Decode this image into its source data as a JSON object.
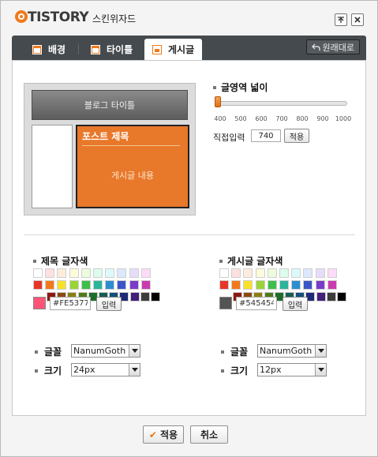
{
  "window": {
    "brand": "TISTORY",
    "title": "스킨위자드",
    "pin_icon": "pin-icon",
    "close_icon": "close-icon"
  },
  "tabs": [
    {
      "label": "배경",
      "icon": "background-icon",
      "active": false
    },
    {
      "label": "타이틀",
      "icon": "title-icon",
      "active": false
    },
    {
      "label": "게시글",
      "icon": "post-icon",
      "active": true
    }
  ],
  "reset_button": {
    "label": "원래대로",
    "icon": "undo-icon"
  },
  "preview": {
    "header_text": "블로그 타이틀",
    "post_title": "포스트 제목",
    "post_body": "게시글 내용",
    "post_color": "#e8782a"
  },
  "width_section": {
    "label": "글영역 넓이",
    "ticks": [
      "400",
      "500",
      "600",
      "700",
      "800",
      "900",
      "1000"
    ],
    "slider_value": 400,
    "direct_label": "직접입력",
    "direct_value": "740",
    "apply_label": "적용"
  },
  "title_color": {
    "label": "제목 글자색",
    "hex_value": "#FE5377",
    "current_color": "#fe5377",
    "input_label": "입력"
  },
  "post_color": {
    "label": "게시글 글자색",
    "hex_value": "#545454",
    "current_color": "#545454",
    "input_label": "입력"
  },
  "palette": {
    "row1": [
      "#ffffff",
      "#fde0e0",
      "#fdecdc",
      "#fdfbdc",
      "#ecfcdc",
      "#dcfcec",
      "#dcfafc",
      "#dce8fc",
      "#e8dcfc",
      "#fcdcfa"
    ],
    "row2": [
      "#e8352a",
      "#f07a1b",
      "#f7e12b",
      "#9ad437",
      "#3dbf4a",
      "#2bb59a",
      "#2b8ed1",
      "#3b55c9",
      "#7b3bc9",
      "#c93baf"
    ],
    "row3": [
      "#8c1a12",
      "#8a4a10",
      "#8a7f12",
      "#4f7a1a",
      "#1d6e28",
      "#165e52",
      "#134f78",
      "#1c2a78",
      "#43207a",
      "#3c3c3c",
      "#000000"
    ]
  },
  "title_font": {
    "font_label": "글꼴",
    "font_value": "NanumGoth",
    "size_label": "크기",
    "size_value": "24px"
  },
  "post_font": {
    "font_label": "글꼴",
    "font_value": "NanumGoth",
    "size_label": "크기",
    "size_value": "12px"
  },
  "footer": {
    "apply_label": "적용",
    "cancel_label": "취소"
  }
}
